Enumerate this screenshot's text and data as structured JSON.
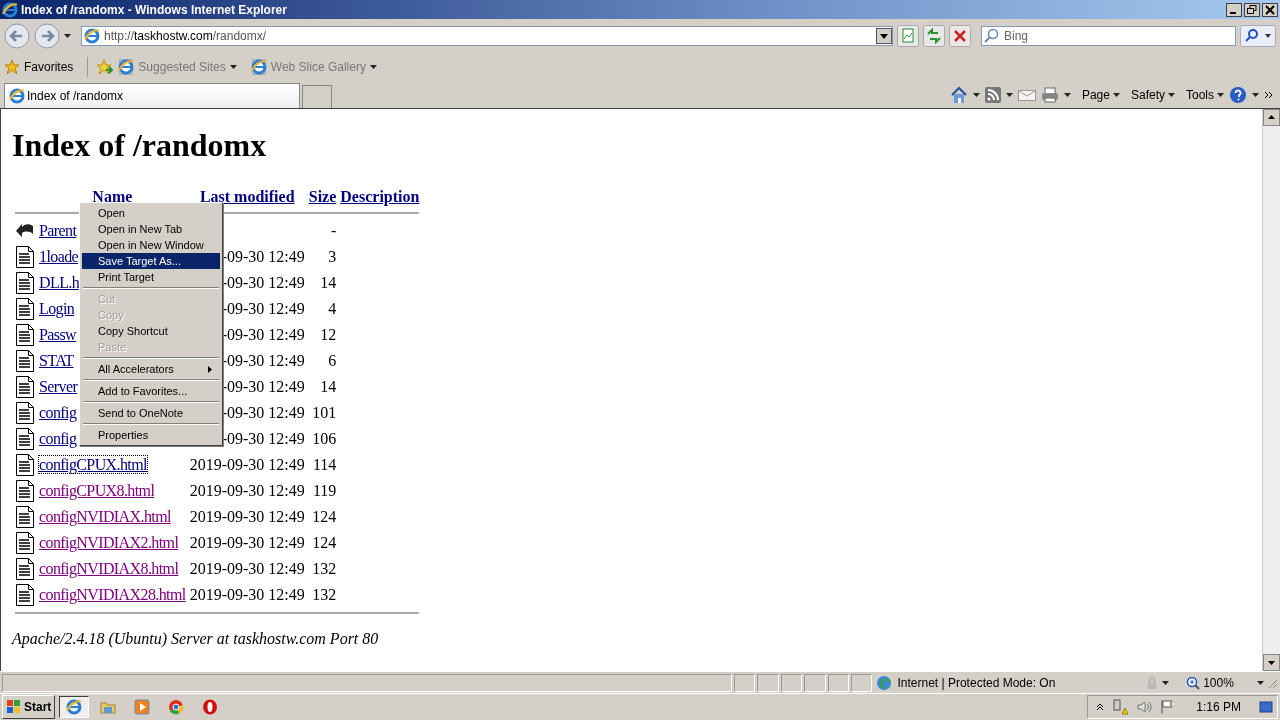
{
  "window": {
    "title": "Index of /randomx - Windows Internet Explorer"
  },
  "navigation": {
    "address": {
      "scheme": "http://",
      "domain": "taskhostw.com",
      "path": "/randomx/"
    },
    "search": {
      "placeholder": "Bing"
    }
  },
  "favorites_bar": {
    "favorites": "Favorites",
    "links": [
      {
        "label": "Suggested Sites"
      },
      {
        "label": "Web Slice Gallery"
      }
    ]
  },
  "tabs": [
    {
      "label": "Index of /randomx",
      "selected": true
    }
  ],
  "command_bar": {
    "menus": [
      {
        "label": "Page"
      },
      {
        "label": "Safety"
      },
      {
        "label": "Tools"
      }
    ]
  },
  "listing": {
    "title": "Index of /randomx",
    "columns": [
      "Name",
      "Last modified",
      "Size",
      "Description"
    ],
    "rows": [
      {
        "kind": "parent",
        "name": "Parent",
        "size": "-",
        "visited": false,
        "focused": false
      },
      {
        "kind": "file",
        "name": "1loade",
        "modified": "-09-30 12:49",
        "size": "3",
        "visited": false,
        "focused": false
      },
      {
        "kind": "file",
        "name": "DLL.h",
        "modified": "-09-30 12:49",
        "size": "14",
        "visited": false,
        "focused": false
      },
      {
        "kind": "file",
        "name": "Login",
        "modified": "-09-30 12:49",
        "size": "4",
        "visited": false,
        "focused": false
      },
      {
        "kind": "file",
        "name": "Passw",
        "modified": "-09-30 12:49",
        "size": "12",
        "visited": false,
        "focused": false
      },
      {
        "kind": "file",
        "name": "STAT",
        "modified": "-09-30 12:49",
        "size": "6",
        "visited": false,
        "focused": false
      },
      {
        "kind": "file",
        "name": "Server",
        "modified": "-09-30 12:49",
        "size": "14",
        "visited": false,
        "focused": false
      },
      {
        "kind": "file",
        "name": "config",
        "modified": "-09-30 12:49",
        "size": "101",
        "visited": false,
        "focused": false
      },
      {
        "kind": "file",
        "name": "config",
        "modified": "-09-30 12:49",
        "size": "106",
        "visited": false,
        "focused": false
      },
      {
        "kind": "file",
        "name": "configCPUX.html",
        "modified": "2019-09-30 12:49",
        "size": "114",
        "visited": false,
        "focused": true
      },
      {
        "kind": "file",
        "name": "configCPUX8.html",
        "modified": "2019-09-30 12:49",
        "size": "119",
        "visited": true,
        "focused": false
      },
      {
        "kind": "file",
        "name": "configNVIDIAX.html",
        "modified": "2019-09-30 12:49",
        "size": "124",
        "visited": true,
        "focused": false
      },
      {
        "kind": "file",
        "name": "configNVIDIAX2.html",
        "modified": "2019-09-30 12:49",
        "size": "124",
        "visited": true,
        "focused": false
      },
      {
        "kind": "file",
        "name": "configNVIDIAX8.html",
        "modified": "2019-09-30 12:49",
        "size": "132",
        "visited": true,
        "focused": false
      },
      {
        "kind": "file",
        "name": "configNVIDIAX28.html",
        "modified": "2019-09-30 12:49",
        "size": "132",
        "visited": true,
        "focused": false
      }
    ],
    "footer": "Apache/2.4.18 (Ubuntu) Server at taskhostw.com Port 80"
  },
  "context_menu": {
    "items": [
      {
        "kind": "item",
        "label": "Open",
        "selected": false,
        "disabled": false
      },
      {
        "kind": "item",
        "label": "Open in New Tab",
        "selected": false,
        "disabled": false
      },
      {
        "kind": "item",
        "label": "Open in New Window",
        "selected": false,
        "disabled": false
      },
      {
        "kind": "item",
        "label": "Save Target As...",
        "selected": true,
        "disabled": false
      },
      {
        "kind": "item",
        "label": "Print Target",
        "selected": false,
        "disabled": false
      },
      {
        "kind": "separator"
      },
      {
        "kind": "item",
        "label": "Cut",
        "selected": false,
        "disabled": true
      },
      {
        "kind": "item",
        "label": "Copy",
        "selected": false,
        "disabled": true
      },
      {
        "kind": "item",
        "label": "Copy Shortcut",
        "selected": false,
        "disabled": false
      },
      {
        "kind": "item",
        "label": "Paste",
        "selected": false,
        "disabled": true
      },
      {
        "kind": "separator"
      },
      {
        "kind": "submenu",
        "label": "All Accelerators",
        "selected": false,
        "disabled": false
      },
      {
        "kind": "separator"
      },
      {
        "kind": "item",
        "label": "Add to Favorites...",
        "selected": false,
        "disabled": false
      },
      {
        "kind": "separator"
      },
      {
        "kind": "item",
        "label": "Send to OneNote",
        "selected": false,
        "disabled": false
      },
      {
        "kind": "separator"
      },
      {
        "kind": "item",
        "label": "Properties",
        "selected": false,
        "disabled": false
      }
    ]
  },
  "status_bar": {
    "zone": "Internet | Protected Mode: On",
    "zoom": "100%"
  },
  "taskbar": {
    "start": "Start",
    "apps": [
      {
        "kind": "ie",
        "active": true
      },
      {
        "kind": "folder",
        "active": false
      },
      {
        "kind": "media",
        "active": false
      },
      {
        "kind": "chrome",
        "active": false
      },
      {
        "kind": "opera",
        "active": false
      }
    ],
    "clock": "1:16 PM"
  }
}
